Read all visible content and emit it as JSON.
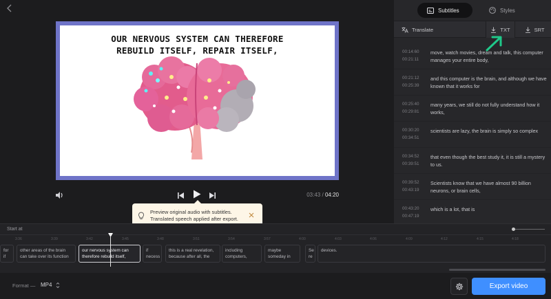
{
  "preview": {
    "caption_line1": "OUR NERVOUS SYSTEM CAN THEREFORE",
    "caption_line2": "REBUILD ITSELF, REPAIR ITSELF,",
    "current_time": "03:43",
    "time_separator": "/",
    "total_time": "04:20"
  },
  "tooltip": {
    "line1": "Preview original audio with subtitles.",
    "line2": "Translated speech applied after export."
  },
  "sidebar": {
    "tabs": [
      {
        "label": "Subtitles",
        "icon": "subtitles-icon",
        "active": true
      },
      {
        "label": "Styles",
        "icon": "palette-icon",
        "active": false
      }
    ],
    "toolbar": {
      "translate_label": "Translate",
      "txt_label": "TXT",
      "srt_label": "SRT"
    },
    "segments": [
      {
        "start": "00:14:60",
        "end": "00:21:11",
        "text": "move, watch movies, dream and talk, this computer manages your entire body,"
      },
      {
        "start": "00:21:12",
        "end": "00:25:39",
        "text": "and this computer is the brain, and although we have known that it works for"
      },
      {
        "start": "00:25:40",
        "end": "00:29:81",
        "text": "many years, we still do not fully understand how it works,"
      },
      {
        "start": "00:30:20",
        "end": "00:34:51",
        "text": "scientists are lazy, the brain is simply so complex"
      },
      {
        "start": "00:34:52",
        "end": "00:39:51",
        "text": "that even though the best study it, it is still a mystery to us."
      },
      {
        "start": "00:39:52",
        "end": "00:43:19",
        "text": "Scientists know that we have almost 90 billion neurons, or brain cells,"
      },
      {
        "start": "00:43:20",
        "end": "00:47:19",
        "text": "which is a lot, that is"
      }
    ]
  },
  "timeline": {
    "start_at_label": "Start at",
    "ticks": [
      "3:36",
      "3:39",
      "3:42",
      "3:45",
      "3:48",
      "3:51",
      "3:54",
      "3:57",
      "4:00",
      "4:03",
      "4:06",
      "4:09",
      "4:12",
      "4:15",
      "4:18"
    ],
    "clips": [
      {
        "line1": "for",
        "line2": "if",
        "active": false
      },
      {
        "line1": "other areas of the brain",
        "line2": "can take over its function",
        "active": false
      },
      {
        "line1": "our nervous system can",
        "line2": "therefore rebuild itself,",
        "active": true
      },
      {
        "line1": "if",
        "line2": "necess",
        "active": false
      },
      {
        "line1": "this is a real revelation,",
        "line2": "because after all, the",
        "active": false
      },
      {
        "line1": "including",
        "line2": "computers,",
        "active": false
      },
      {
        "line1": "maybe",
        "line2": "someday in",
        "active": false
      },
      {
        "line1": "Se",
        "line2": "re",
        "active": false
      },
      {
        "line1": "devices.",
        "line2": "",
        "active": false
      }
    ]
  },
  "footer": {
    "format_label": "Format —",
    "format_value": "MP4",
    "export_label": "Export video"
  },
  "colors": {
    "accent": "#3f8fff",
    "frame_border": "#6f74c8",
    "arrow_green": "#1fc98a",
    "tooltip_bg": "#fdf6e7"
  }
}
